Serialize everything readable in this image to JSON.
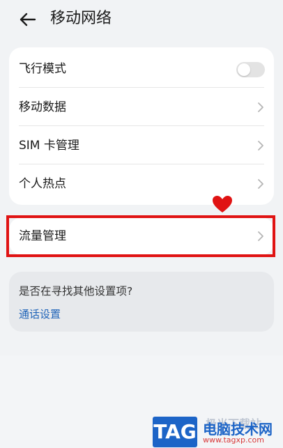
{
  "header": {
    "title": "移动网络",
    "back_icon": "arrow-left-icon"
  },
  "settings": [
    {
      "label": "飞行模式",
      "control": "toggle",
      "on": false
    },
    {
      "label": "移动数据",
      "control": "chevron"
    },
    {
      "label": "SIM 卡管理",
      "control": "chevron"
    },
    {
      "label": "个人热点",
      "control": "chevron"
    }
  ],
  "traffic": {
    "label": "流量管理",
    "highlighted": true,
    "highlight_color": "#e01313"
  },
  "suggest": {
    "title": "是否在寻找其他设置项?",
    "link": "通话设置"
  },
  "watermark": {
    "badge": "TAG",
    "name": "电脑技术网",
    "url": "www.tagxp.com",
    "faded_text": "极光下载站"
  },
  "colors": {
    "background": "#f1f3f5",
    "link": "#1e63b8",
    "accent_red": "#e01313",
    "brand_blue": "#1c64c7"
  }
}
